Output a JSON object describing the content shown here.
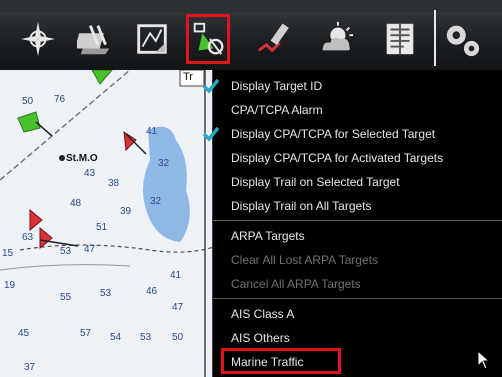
{
  "toolbar": {
    "buttons": [
      {
        "name": "compass-rose-icon"
      },
      {
        "name": "tide-current-icon"
      },
      {
        "name": "chart-layers-icon"
      },
      {
        "name": "target-ais-icon"
      },
      {
        "name": "route-pen-icon"
      },
      {
        "name": "weather-icon"
      },
      {
        "name": "notes-icon"
      },
      {
        "name": "settings-gears-icon"
      }
    ]
  },
  "chart": {
    "depths": [
      "50",
      "76",
      "41",
      "32",
      "43",
      "38",
      "48",
      "39",
      "32",
      "63",
      "51",
      "53",
      "47",
      "15",
      "41",
      "19",
      "55",
      "53",
      "46",
      "47",
      "45",
      "57",
      "54",
      "53",
      "50",
      "37"
    ],
    "place_label": "St.M.O",
    "badge_label": "Tr"
  },
  "menu": {
    "items": [
      {
        "label": "Display Target ID",
        "checked": true,
        "disabled": false
      },
      {
        "label": "CPA/TCPA Alarm",
        "checked": false,
        "disabled": false
      },
      {
        "label": "Display CPA/TCPA for Selected Target",
        "checked": true,
        "disabled": false
      },
      {
        "label": "Display CPA/TCPA for Activated Targets",
        "checked": false,
        "disabled": false
      },
      {
        "label": "Display Trail on Selected Target",
        "checked": false,
        "disabled": false
      },
      {
        "label": "Display Trail on All Targets",
        "checked": false,
        "disabled": false
      },
      {
        "label": "ARPA Targets",
        "checked": false,
        "disabled": false
      },
      {
        "label": "Clear All Lost ARPA Targets",
        "checked": false,
        "disabled": true
      },
      {
        "label": "Cancel All ARPA Targets",
        "checked": false,
        "disabled": true
      },
      {
        "label": "AIS Class A",
        "checked": false,
        "disabled": false
      },
      {
        "label": "AIS Others",
        "checked": false,
        "disabled": false
      },
      {
        "label": "Marine Traffic",
        "checked": false,
        "disabled": false
      }
    ]
  },
  "colors": {
    "highlight": "#e0141a",
    "check": "#2aa7c9",
    "target_red": "#d8323a",
    "target_green": "#46c22c"
  }
}
